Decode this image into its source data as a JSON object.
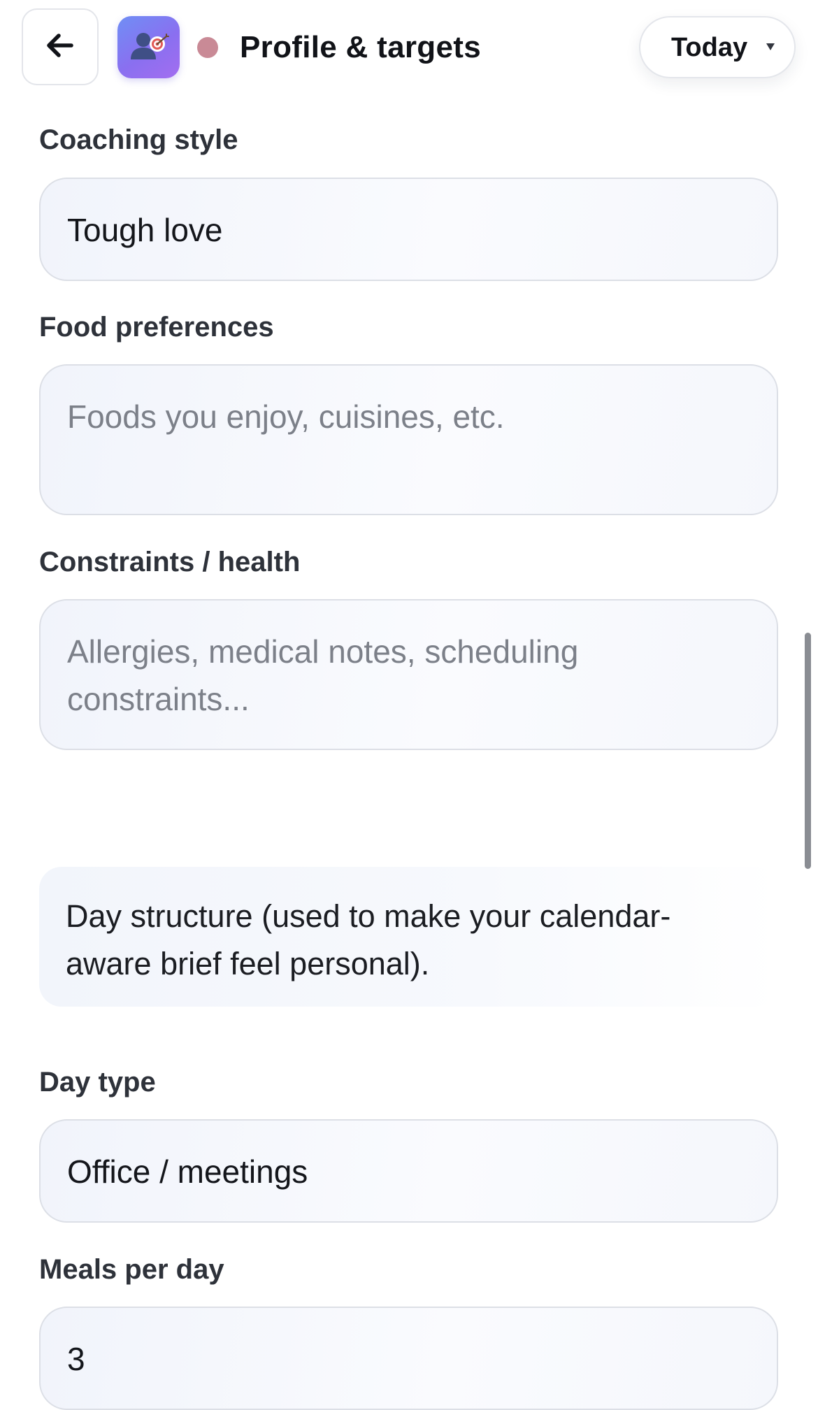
{
  "header": {
    "back_icon": "arrow-left-icon",
    "app_icon": "profile-target-icon",
    "title": "Profile & targets",
    "date_selector": {
      "value": "Today",
      "icon": "caret-down-icon"
    }
  },
  "form": {
    "coaching_style": {
      "label": "Coaching style",
      "value": "Tough love"
    },
    "food_preferences": {
      "label": "Food preferences",
      "placeholder": "Foods you enjoy, cuisines, etc."
    },
    "constraints": {
      "label": "Constraints / health",
      "placeholder": "Allergies, medical notes, scheduling constraints..."
    },
    "day_structure_note": "Day structure (used to make your calendar-aware brief feel personal).",
    "day_type": {
      "label": "Day type",
      "value": "Office / meetings"
    },
    "meals_per_day": {
      "label": "Meals per day",
      "value": "3"
    }
  },
  "colors": {
    "status_dot": "#c98a96",
    "app_icon_gradient_start": "#6f8ff5",
    "app_icon_gradient_end": "#a36ef0"
  }
}
